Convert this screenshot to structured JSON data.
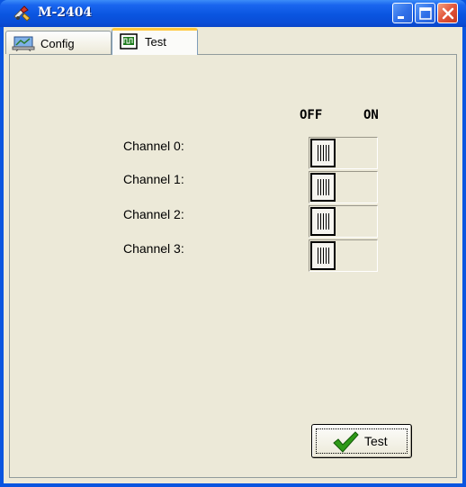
{
  "window": {
    "title": "M-2404",
    "tabs": [
      {
        "label": "Config",
        "selected": false
      },
      {
        "label": "Test",
        "selected": true
      }
    ]
  },
  "test_panel": {
    "column_headers": {
      "off": "OFF",
      "on": "ON"
    },
    "channels": [
      {
        "label": "Channel 0:",
        "state": "OFF"
      },
      {
        "label": "Channel 1:",
        "state": "OFF"
      },
      {
        "label": "Channel 2:",
        "state": "OFF"
      },
      {
        "label": "Channel 3:",
        "state": "OFF"
      }
    ],
    "test_button_label": "Test"
  },
  "colors": {
    "title_bar": "#0a55e0",
    "dialog_background": "#ece9d8",
    "active_tab_highlight": "#ffc83c",
    "check_icon": "#2f9a18"
  },
  "icons": [
    "app-icon",
    "minimize-icon",
    "maximize-icon",
    "close-icon",
    "config-tab-icon",
    "test-tab-icon",
    "checkmark-icon"
  ]
}
